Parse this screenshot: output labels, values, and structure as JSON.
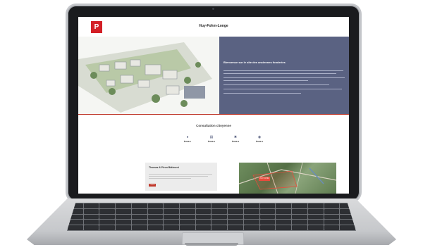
{
  "site": {
    "title": "Huy-Fohm-Longe",
    "logo_text": "P",
    "accent_color": "#c0392b",
    "panel_color": "#5a6282"
  },
  "hero": {
    "heading": "Bienvenue sur le site des anciennes fonderies"
  },
  "consultation": {
    "title": "Consultation citoyenne",
    "steps": [
      {
        "icon": "pin-icon",
        "label": "ÉTAPE 1"
      },
      {
        "icon": "book-icon",
        "label": "ÉTAPE 2"
      },
      {
        "icon": "tools-icon",
        "label": "ÉTAPE 3"
      },
      {
        "icon": "chat-icon",
        "label": "ÉTAPE 4"
      }
    ]
  },
  "card": {
    "title": "Thomas & Piron Bâtiment",
    "button_label": "Contact"
  },
  "map": {
    "tag": "HUY-FOHM"
  }
}
